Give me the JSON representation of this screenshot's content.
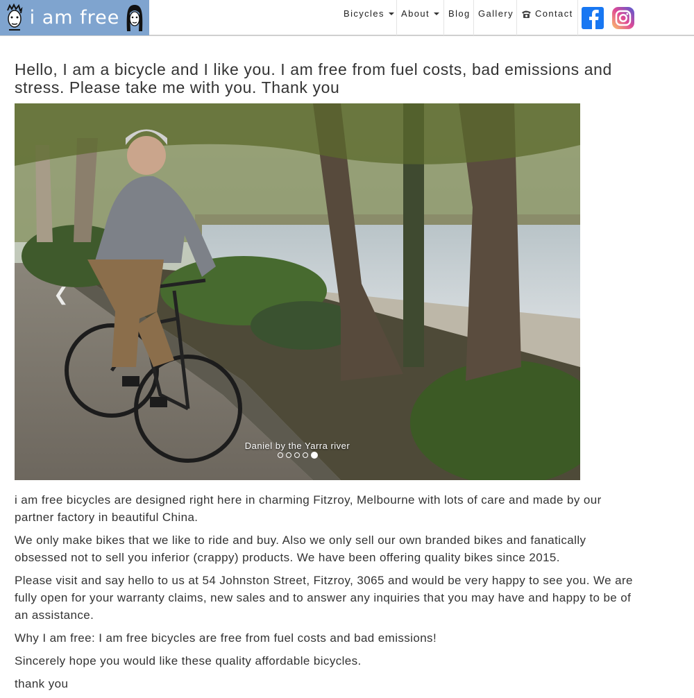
{
  "logo": {
    "text": "i am free"
  },
  "nav": {
    "items": [
      {
        "label": "Bicycles",
        "dropdown": true
      },
      {
        "label": "About",
        "dropdown": true
      },
      {
        "label": "Blog",
        "dropdown": false
      },
      {
        "label": "Gallery",
        "dropdown": false
      },
      {
        "label": "Contact",
        "dropdown": false,
        "icon": "telephone-icon"
      }
    ]
  },
  "social": {
    "facebook_icon": "facebook-icon",
    "instagram_icon": "instagram-icon"
  },
  "heading": "Hello, I am a bicycle and I like you. I am free from fuel costs, bad emissions and stress. Please take me with you. Thank you",
  "carousel": {
    "caption": "Daniel by the Yarra river",
    "slide_count": 5,
    "active_index": 4
  },
  "body": {
    "paragraphs": [
      "i am free bicycles are designed right here in charming Fitzroy, Melbourne with lots of care and made by our partner factory in beautiful China.",
      "We only make bikes that we like to ride and buy. Also we only sell our own branded bikes and fanatically obsessed not to sell you inferior (crappy) products. We have been offering quality bikes since 2015.",
      "Please visit and say hello to us at 54 Johnston Street, Fitzroy, 3065 and would be very happy to see you. We are fully open for your warranty claims, new sales and to answer any inquiries that you may have and happy to be of an assistance.",
      "Why I am free: I am free bicycles are free from fuel costs and bad emissions!",
      "Sincerely hope you would like these quality affordable bicycles.",
      "thank you"
    ]
  },
  "colors": {
    "logo_bg": "#7fa4cf",
    "facebook": "#1877f2"
  }
}
